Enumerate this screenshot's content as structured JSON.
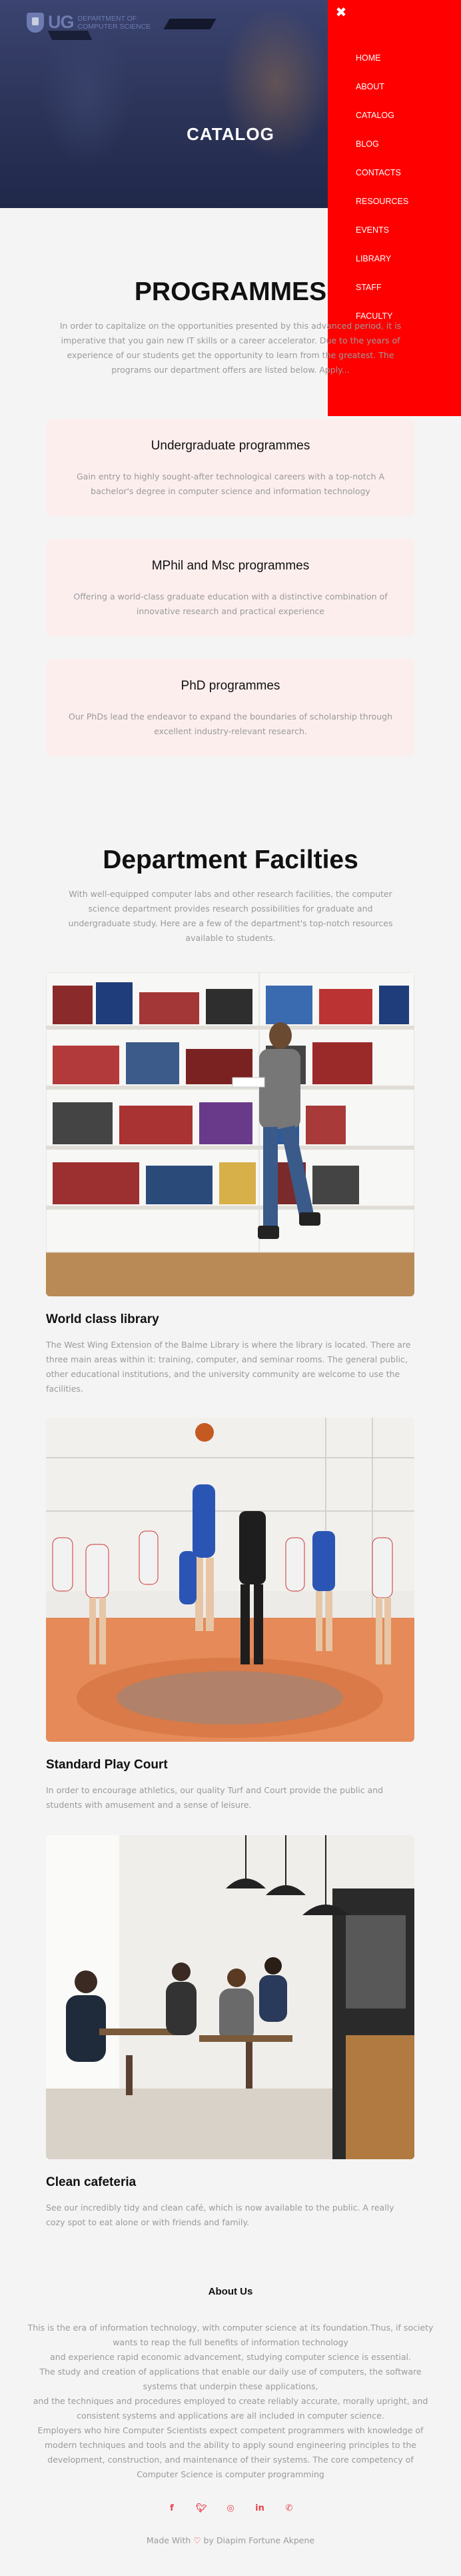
{
  "hero": {
    "title": "CATALOG",
    "logo_letters": "UG",
    "logo_line1": "DEPARTMENT OF",
    "logo_line2": "COMPUTER SCIENCE"
  },
  "nav": {
    "close_icon": "close-icon",
    "items": [
      "HOME",
      "ABOUT",
      "CATALOG",
      "BLOG",
      "CONTACTS",
      "RESOURCES",
      "EVENTS",
      "LIBRARY",
      "STAFF",
      "FACULTY"
    ],
    "background": "#ff0000"
  },
  "programmes": {
    "heading": "PROGRAMMES",
    "intro": "In order to capitalize on the opportunities presented by this advanced period, it is imperative that you gain new IT skills or a career accelerator. Due to the years of experience of our students get the opportunity to learn from the greatest. The programs our department offers are listed below. Apply...",
    "cards": [
      {
        "title": "Undergraduate programmes",
        "text": "Gain entry to highly sought-after technological careers with a top-notch A bachelor's degree in computer science and information technology"
      },
      {
        "title": "MPhil and Msc programmes",
        "text": "Offering a world-class graduate education with a distinctive combination of innovative research and practical experience"
      },
      {
        "title": "PhD programmes",
        "text": "Our PhDs lead the endeavor to expand the boundaries of scholarship through excellent industry-relevant research."
      }
    ]
  },
  "facilities": {
    "heading": "Department Facilties",
    "intro": "With well-equipped computer labs and other research facilities, the computer science department provides research possibilities for graduate and undergraduate study. Here are a few of the department's top-notch resources available to students.",
    "items": [
      {
        "title": "World class library",
        "text": "The West Wing Extension of the Balme Library is where the library is located. There are three main areas within it: training, computer, and seminar rooms. The general public, other educational institutions, and the university community are welcome to use the facilities."
      },
      {
        "title": "Standard Play Court",
        "text": "In order to encourage athletics, our quality Turf and Court provide the public and students with amusement and a sense of leisure."
      },
      {
        "title": "Clean cafeteria",
        "text": "See our incredibly tidy and clean café, which is now available to the public. A really cozy spot to eat alone or with friends and family."
      }
    ]
  },
  "about": {
    "heading": "About Us",
    "lines": [
      "This is the era of information technology, with computer science at its foundation.Thus, if society",
      "wants to reap the full benefits of information technology",
      "and experience rapid economic advancement, studying computer science is essential.",
      "The study and creation of applications that enable our daily use of computers, the software",
      "systems that underpin these applications,",
      "and the techniques and procedures employed to create reliably accurate, morally upright, and",
      "consistent systems and applications are all included in computer science.",
      "Employers who hire Computer Scientists expect competent programmers with knowledge of",
      "modern techniques and tools and the ability to apply sound engineering principles to the",
      "development, construction, and maintenance of their systems. The core competency of",
      "Computer Science is computer programming"
    ]
  },
  "socials": [
    "facebook-icon",
    "twitter-icon",
    "instagram-icon",
    "linkedin-icon",
    "whatsapp-icon"
  ],
  "footer": {
    "made_prefix": "Made With",
    "made_suffix": "by Diapim Fortune Akpene"
  },
  "colors": {
    "accent": "#e8414a",
    "card_bg": "#fdeeee"
  }
}
